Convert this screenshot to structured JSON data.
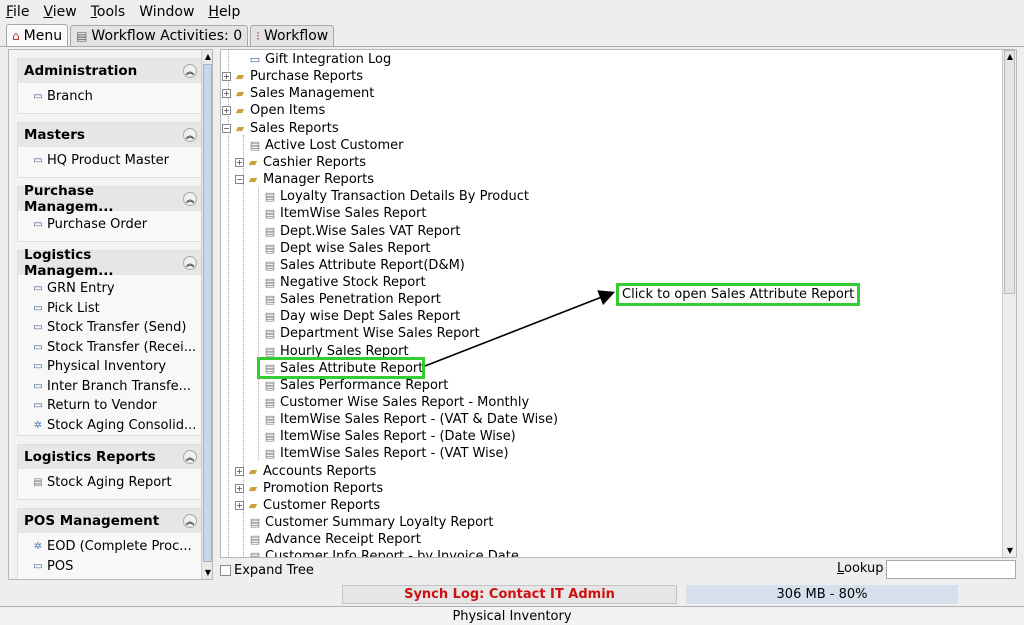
{
  "menu": [
    "File",
    "View",
    "Tools",
    "Window",
    "Help"
  ],
  "tabs": [
    {
      "label": "Menu",
      "icon": "home-icon"
    },
    {
      "label": "Workflow Activities: 0",
      "icon": "document-icon"
    },
    {
      "label": "Workflow",
      "icon": "workflow-icon"
    }
  ],
  "sidebar": {
    "groups": [
      {
        "title": "Administration",
        "items": [
          {
            "label": "Branch",
            "icon": "window-icon"
          }
        ]
      },
      {
        "title": "Masters",
        "items": [
          {
            "label": "HQ Product Master",
            "icon": "window-icon"
          }
        ]
      },
      {
        "title": "Purchase Managem...",
        "items": [
          {
            "label": "Purchase Order",
            "icon": "window-icon"
          }
        ]
      },
      {
        "title": "Logistics Managem...",
        "items": [
          {
            "label": "GRN Entry",
            "icon": "window-icon"
          },
          {
            "label": "Pick List",
            "icon": "window-icon"
          },
          {
            "label": "Stock Transfer (Send)",
            "icon": "window-icon"
          },
          {
            "label": "Stock Transfer (Recei...",
            "icon": "window-icon"
          },
          {
            "label": "Physical Inventory",
            "icon": "window-icon"
          },
          {
            "label": "Inter Branch Transfe...",
            "icon": "window-icon"
          },
          {
            "label": "Return to Vendor",
            "icon": "window-icon"
          },
          {
            "label": "Stock Aging Consolid...",
            "icon": "gear-icon"
          }
        ]
      },
      {
        "title": "Logistics Reports",
        "items": [
          {
            "label": "Stock Aging Report",
            "icon": "report-icon"
          }
        ]
      },
      {
        "title": "POS Management",
        "items": [
          {
            "label": "EOD (Complete Proc...",
            "icon": "gear-icon"
          },
          {
            "label": "POS",
            "icon": "window-icon"
          }
        ]
      }
    ]
  },
  "tree": [
    {
      "label": "Gift Integration Log",
      "level": 1,
      "kind": "window"
    },
    {
      "label": "Purchase Reports",
      "level": 0,
      "kind": "folder",
      "expanded": false
    },
    {
      "label": "Sales Management",
      "level": 0,
      "kind": "folder",
      "expanded": false
    },
    {
      "label": "Open Items",
      "level": 0,
      "kind": "folder",
      "expanded": false
    },
    {
      "label": "Sales Reports",
      "level": 0,
      "kind": "folder",
      "expanded": true
    },
    {
      "label": "Active Lost Customer",
      "level": 1,
      "kind": "report"
    },
    {
      "label": "Cashier Reports",
      "level": 1,
      "kind": "folder",
      "expanded": false
    },
    {
      "label": "Manager Reports",
      "level": 1,
      "kind": "folder",
      "expanded": true
    },
    {
      "label": "Loyalty Transaction Details By Product",
      "level": 2,
      "kind": "report"
    },
    {
      "label": "ItemWise Sales Report",
      "level": 2,
      "kind": "report"
    },
    {
      "label": "Dept.Wise Sales VAT Report",
      "level": 2,
      "kind": "report"
    },
    {
      "label": "Dept wise Sales Report",
      "level": 2,
      "kind": "report"
    },
    {
      "label": "Sales Attribute Report(D&M)",
      "level": 2,
      "kind": "report"
    },
    {
      "label": "Negative Stock Report",
      "level": 2,
      "kind": "report"
    },
    {
      "label": "Sales Penetration Report",
      "level": 2,
      "kind": "report"
    },
    {
      "label": "Day wise Dept Sales Report",
      "level": 2,
      "kind": "report"
    },
    {
      "label": "Department Wise Sales Report",
      "level": 2,
      "kind": "report"
    },
    {
      "label": "Hourly Sales Report",
      "level": 2,
      "kind": "report"
    },
    {
      "label": "Sales Attribute Report",
      "level": 2,
      "kind": "report",
      "highlighted": true
    },
    {
      "label": "Sales Performance Report",
      "level": 2,
      "kind": "report"
    },
    {
      "label": "Customer Wise Sales Report - Monthly",
      "level": 2,
      "kind": "report"
    },
    {
      "label": "ItemWise Sales Report - (VAT & Date Wise)",
      "level": 2,
      "kind": "report"
    },
    {
      "label": "ItemWise Sales Report - (Date Wise)",
      "level": 2,
      "kind": "report"
    },
    {
      "label": "ItemWise Sales Report - (VAT Wise)",
      "level": 2,
      "kind": "report"
    },
    {
      "label": "Accounts Reports",
      "level": 1,
      "kind": "folder",
      "expanded": false
    },
    {
      "label": "Promotion Reports",
      "level": 1,
      "kind": "folder",
      "expanded": false
    },
    {
      "label": "Customer Reports",
      "level": 1,
      "kind": "folder",
      "expanded": false
    },
    {
      "label": "Customer Summary Loyalty Report",
      "level": 1,
      "kind": "report"
    },
    {
      "label": "Advance Receipt Report",
      "level": 1,
      "kind": "report"
    },
    {
      "label": "Customer Info Report - by Invoice Date",
      "level": 1,
      "kind": "report"
    }
  ],
  "footer": {
    "expand_tree": "Expand Tree",
    "lookup": "Lookup",
    "lookup_value": ""
  },
  "status": {
    "synch_log": "Synch Log: Contact IT Admin",
    "memory": "306 MB - 80%",
    "message": "Physical Inventory",
    "synch_color": "#cc1111"
  },
  "annotation": {
    "callout": "Click to open Sales Attribute Report",
    "color": "#33cc33"
  }
}
